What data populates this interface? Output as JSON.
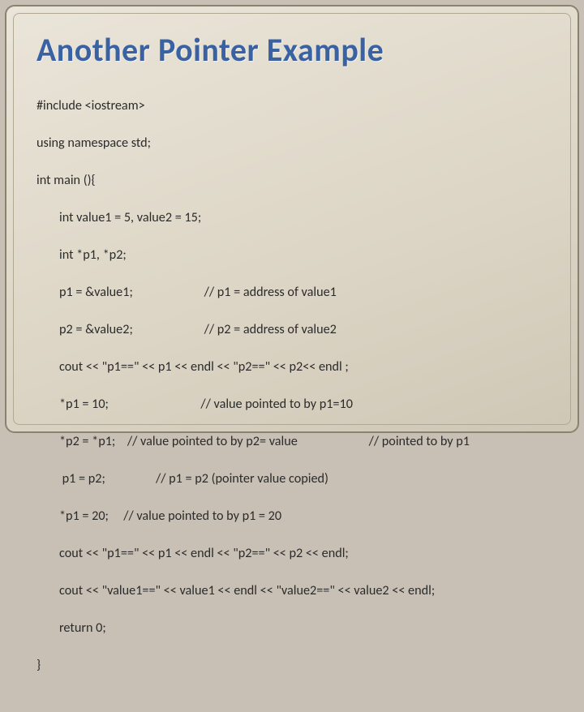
{
  "title": "Another Pointer Example",
  "code": {
    "l1": "#include <iostream>",
    "l2": "using namespace std;",
    "l3": "int main (){",
    "l4": "int value1 = 5, value2 = 15;",
    "l5": "int *p1, *p2;",
    "l6": "p1 = &value1;                        // p1 = address of value1",
    "l7": "p2 = &value2;                        // p2 = address of value2",
    "l8": "cout << \"p1==\" << p1 << endl << \"p2==\" << p2<< endl ;",
    "l9": "*p1 = 10;                               // value pointed to by p1=10",
    "l10": "*p2 = *p1;    // value pointed to by p2= value                        // pointed to by p1",
    "l11": " p1 = p2;                 // p1 = p2 (pointer value copied)",
    "l12": "*p1 = 20;     // value pointed to by p1 = 20",
    "l13": "cout << \"p1==\" << p1 << endl << \"p2==\" << p2 << endl;",
    "l14": "cout << \"value1==\" << value1 << endl << \"value2==\" << value2 << endl;",
    "l15": "return 0;",
    "l16": "}"
  }
}
